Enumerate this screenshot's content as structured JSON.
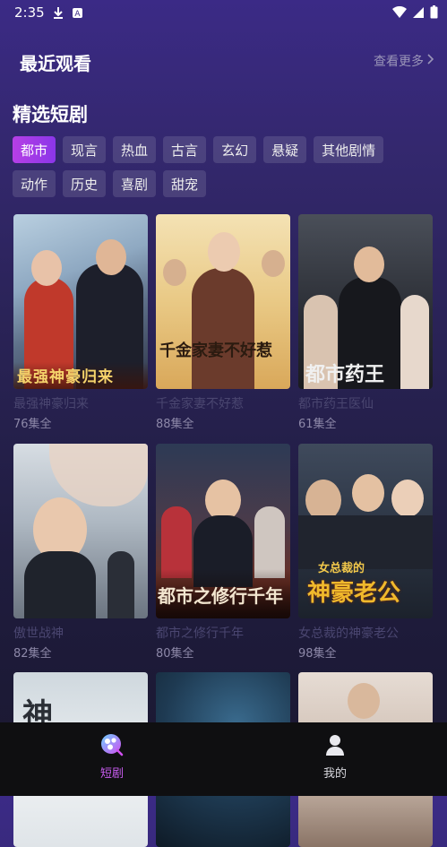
{
  "status": {
    "time": "2:35"
  },
  "recent": {
    "title": "最近观看",
    "see_more": "查看更多"
  },
  "section": {
    "title": "精选短剧"
  },
  "categories": {
    "row1": [
      "都市",
      "现言",
      "热血",
      "古言",
      "玄幻",
      "悬疑",
      "其他剧情"
    ],
    "row2": [
      "动作",
      "历史",
      "喜剧",
      "甜宠"
    ]
  },
  "dramas": [
    {
      "title": "最强神豪归来",
      "episodes": "76集全"
    },
    {
      "title": "千金家妻不好惹",
      "episodes": "88集全"
    },
    {
      "title": "都市药王医仙",
      "episodes": "61集全"
    },
    {
      "title": "傲世战神",
      "episodes": "82集全"
    },
    {
      "title": "都市之修行千年",
      "episodes": "80集全"
    },
    {
      "title": "女总裁的神豪老公",
      "episodes": "98集全"
    }
  ],
  "posters": {
    "p1": "最强神豪归来",
    "p2": "千金家妻不好惹",
    "p3": "都市药王",
    "p5": "都市之修行千年",
    "p6a": "女总裁的",
    "p6b": "神豪老公"
  },
  "bottom_nav": {
    "shorts": "短剧",
    "mine": "我的"
  },
  "colors": {
    "accent": "#b63fe6",
    "nav_active": "#c85cf0"
  }
}
